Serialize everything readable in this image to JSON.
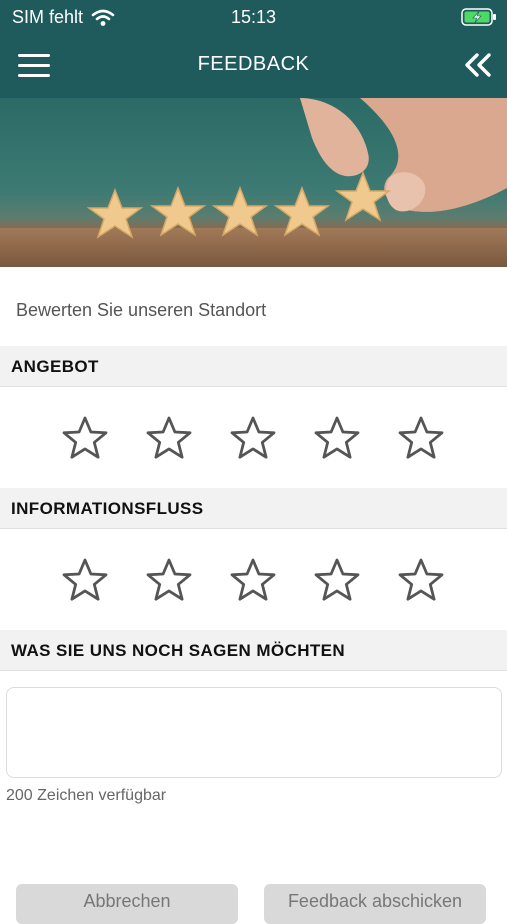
{
  "status_bar": {
    "carrier": "SIM fehlt",
    "time": "15:13",
    "icons": [
      "wifi-icon",
      "battery-charging-icon"
    ]
  },
  "navbar": {
    "title": "FEEDBACK",
    "left_icon": "menu-icon",
    "right_icon": "double-chevron-left-icon",
    "background": "#1f5b5d"
  },
  "prompt": "Bewerten Sie unseren Standort",
  "sections": [
    {
      "title": "ANGEBOT",
      "rating": 0,
      "max": 5
    },
    {
      "title": "INFORMATIONSFLUSS",
      "rating": 0,
      "max": 5
    },
    {
      "title": "WAS SIE UNS NOCH SAGEN MÖCHTEN"
    }
  ],
  "message": {
    "value": "",
    "counter": "200 Zeichen verfügbar"
  },
  "buttons": {
    "cancel": "Abbrechen",
    "submit": "Feedback abschicken"
  }
}
